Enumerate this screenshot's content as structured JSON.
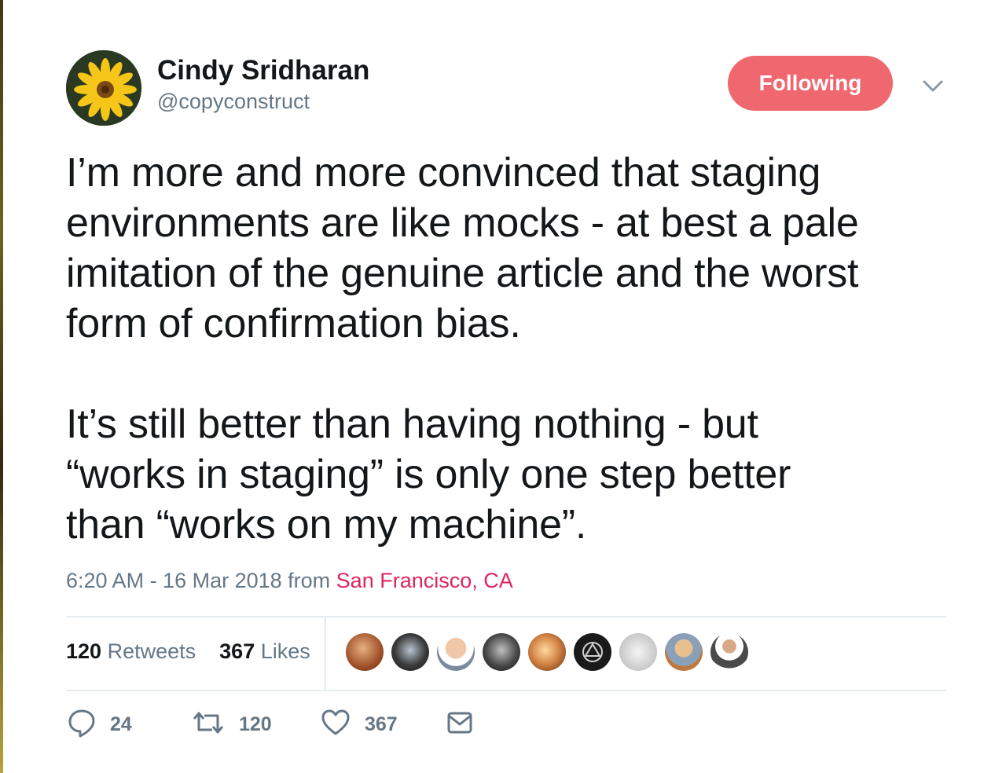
{
  "author": {
    "name": "Cindy Sridharan",
    "handle": "@copyconstruct"
  },
  "follow_button": {
    "label": "Following",
    "color": "#f0686f"
  },
  "tweet": {
    "lines": [
      "I’m more and more convinced that staging",
      "environments are like mocks - at best a pale",
      "imitation of the genuine article and the worst",
      "form of confirmation bias.",
      "It’s still better than having nothing - but",
      "“works in staging” is only one step better",
      "than “works on my machine”."
    ]
  },
  "meta": {
    "time": "6:20 AM - 16 Mar 2018 from ",
    "location": "San Francisco, CA",
    "location_color": "#e0245e"
  },
  "stats": {
    "retweets_count": "120",
    "retweets_label": "Retweets",
    "likes_count": "367",
    "likes_label": "Likes"
  },
  "actions": {
    "replies": "24",
    "retweets": "120",
    "likes": "367"
  },
  "icons": [
    "chevron-down-icon",
    "reply-icon",
    "retweet-icon",
    "heart-icon",
    "direct-message-icon"
  ]
}
